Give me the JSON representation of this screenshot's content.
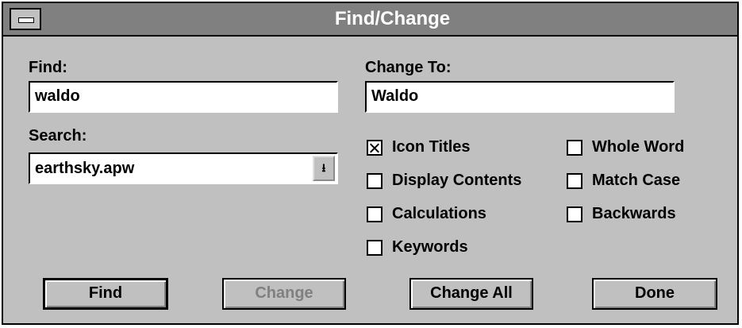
{
  "window": {
    "title": "Find/Change"
  },
  "find": {
    "label": "Find:",
    "value": "waldo"
  },
  "change_to": {
    "label": "Change To:",
    "value": "Waldo"
  },
  "search": {
    "label": "Search:",
    "value": "earthsky.apw"
  },
  "options_left": [
    {
      "label": "Icon Titles",
      "checked": true
    },
    {
      "label": "Display Contents",
      "checked": false
    },
    {
      "label": "Calculations",
      "checked": false
    },
    {
      "label": "Keywords",
      "checked": false
    }
  ],
  "options_right": [
    {
      "label": "Whole Word",
      "checked": false
    },
    {
      "label": "Match Case",
      "checked": false
    },
    {
      "label": "Backwards",
      "checked": false
    }
  ],
  "buttons": {
    "find": "Find",
    "change": "Change",
    "change_all": "Change All",
    "done": "Done"
  }
}
